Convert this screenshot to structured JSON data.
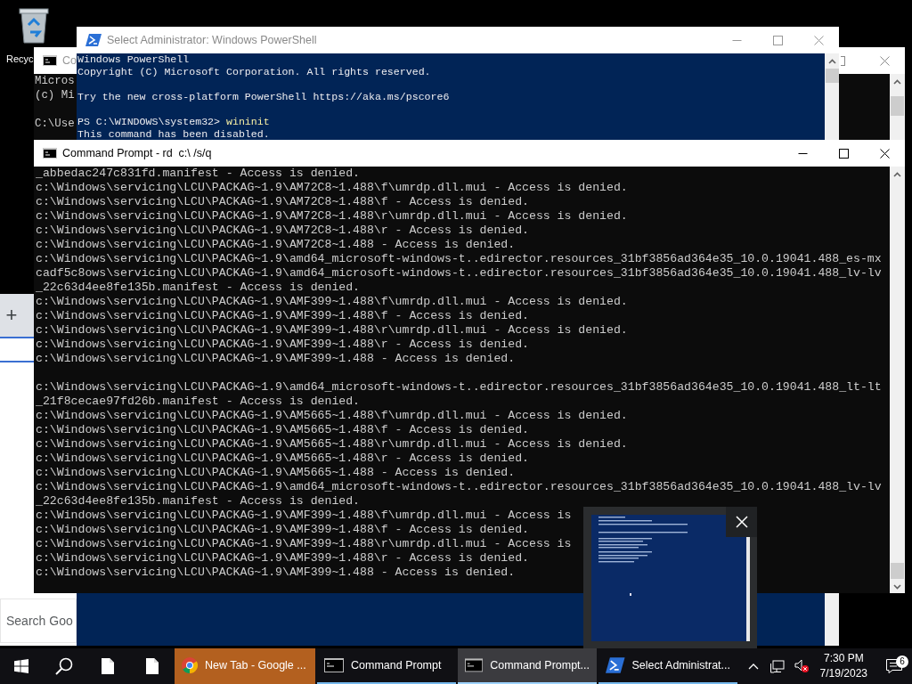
{
  "desktop_icons": [
    {
      "label": "Recyc"
    }
  ],
  "browser_window": {
    "new_tab_symbol": "+",
    "search": {
      "placeholder": "Search Goo"
    }
  },
  "background_console": {
    "title": "Co",
    "output_blocks": [
      [
        "Micros",
        "(c) Mi"
      ],
      [
        "C:\\Use"
      ]
    ]
  },
  "powershell_window": {
    "title": "Select Administrator: Windows PowerShell",
    "output_blocks": [
      [
        "Windows PowerShell",
        "Copyright (C) Microsoft Corporation. All rights reserved."
      ],
      [
        "Try the new cross-platform PowerShell https://aka.ms/pscore6"
      ]
    ],
    "prompt": "PS C:\\WINDOWS\\system32>",
    "command": "wininit",
    "response": "This command has been disabled."
  },
  "command_prompt": {
    "title": "Command Prompt - rd  c:\\ /s/q",
    "output_blocks": [
      [
        "_abbedac247c831fd.manifest - Access is denied.",
        "c:\\Windows\\servicing\\LCU\\PACKAG~1.9\\AM72C8~1.488\\f\\umrdp.dll.mui - Access is denied.",
        "c:\\Windows\\servicing\\LCU\\PACKAG~1.9\\AM72C8~1.488\\f - Access is denied.",
        "c:\\Windows\\servicing\\LCU\\PACKAG~1.9\\AM72C8~1.488\\r\\umrdp.dll.mui - Access is denied.",
        "c:\\Windows\\servicing\\LCU\\PACKAG~1.9\\AM72C8~1.488\\r - Access is denied.",
        "c:\\Windows\\servicing\\LCU\\PACKAG~1.9\\AM72C8~1.488 - Access is denied.",
        "c:\\Windows\\servicing\\LCU\\PACKAG~1.9\\amd64_microsoft-windows-t..edirector.resources_31bf3856ad364e35_10.0.19041.488_es-mx",
        "cadf5c8ows\\servicing\\LCU\\PACKAG~1.9\\amd64_microsoft-windows-t..edirector.resources_31bf3856ad364e35_10.0.19041.488_lv-lv",
        "_22c63d4ee8fe135b.manifest - Access is denied.",
        "c:\\Windows\\servicing\\LCU\\PACKAG~1.9\\AMF399~1.488\\f\\umrdp.dll.mui - Access is denied.",
        "c:\\Windows\\servicing\\LCU\\PACKAG~1.9\\AMF399~1.488\\f - Access is denied.",
        "c:\\Windows\\servicing\\LCU\\PACKAG~1.9\\AMF399~1.488\\r\\umrdp.dll.mui - Access is denied.",
        "c:\\Windows\\servicing\\LCU\\PACKAG~1.9\\AMF399~1.488\\r - Access is denied.",
        "c:\\Windows\\servicing\\LCU\\PACKAG~1.9\\AMF399~1.488 - Access is denied."
      ],
      [
        "c:\\Windows\\servicing\\LCU\\PACKAG~1.9\\amd64_microsoft-windows-t..edirector.resources_31bf3856ad364e35_10.0.19041.488_lt-lt",
        "_21f8cecae97fd26b.manifest - Access is denied.",
        "c:\\Windows\\servicing\\LCU\\PACKAG~1.9\\AM5665~1.488\\f\\umrdp.dll.mui - Access is denied.",
        "c:\\Windows\\servicing\\LCU\\PACKAG~1.9\\AM5665~1.488\\f - Access is denied.",
        "c:\\Windows\\servicing\\LCU\\PACKAG~1.9\\AM5665~1.488\\r\\umrdp.dll.mui - Access is denied.",
        "c:\\Windows\\servicing\\LCU\\PACKAG~1.9\\AM5665~1.488\\r - Access is denied.",
        "c:\\Windows\\servicing\\LCU\\PACKAG~1.9\\AM5665~1.488 - Access is denied.",
        "c:\\Windows\\servicing\\LCU\\PACKAG~1.9\\amd64_microsoft-windows-t..edirector.resources_31bf3856ad364e35_10.0.19041.488_lv-lv",
        "_22c63d4ee8fe135b.manifest - Access is denied.",
        "c:\\Windows\\servicing\\LCU\\PACKAG~1.9\\AMF399~1.488\\f\\umrdp.dll.mui - Access is",
        "c:\\Windows\\servicing\\LCU\\PACKAG~1.9\\AMF399~1.488\\f - Access is denied.",
        "c:\\Windows\\servicing\\LCU\\PACKAG~1.9\\AMF399~1.488\\r\\umrdp.dll.mui - Access is",
        "c:\\Windows\\servicing\\LCU\\PACKAG~1.9\\AMF399~1.488\\r - Access is denied.",
        "c:\\Windows\\servicing\\LCU\\PACKAG~1.9\\AMF399~1.488 - Access is denied."
      ]
    ]
  },
  "taskbar": {
    "buttons": [
      {
        "kind": "browser",
        "label": "New Tab - Google ...",
        "flashing": true,
        "selected": false
      },
      {
        "kind": "console",
        "label": "Command Prompt",
        "flashing": false,
        "selected": false
      },
      {
        "kind": "console",
        "label": "Command Prompt...",
        "flashing": false,
        "selected": true
      },
      {
        "kind": "powershell",
        "label": "Select Administrat...",
        "flashing": false,
        "selected": false
      }
    ],
    "clock": {
      "time": "7:30 PM",
      "date": "7/19/2023"
    },
    "notifications": {
      "count": "6"
    }
  }
}
